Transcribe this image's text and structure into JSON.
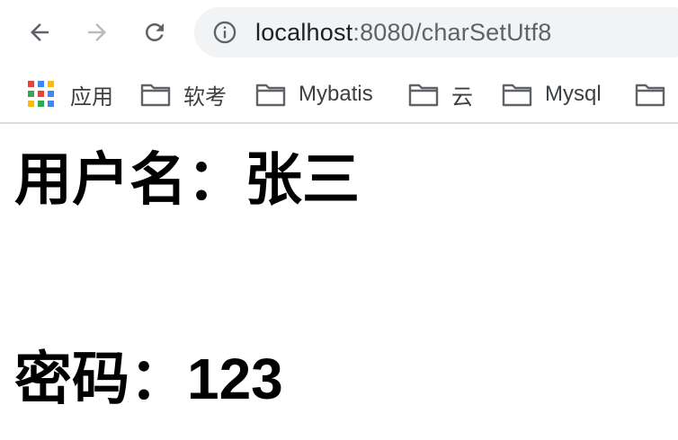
{
  "toolbar": {
    "url_host": "localhost",
    "url_rest": ":8080/charSetUtf8"
  },
  "bookmarks": {
    "apps_label": "应用",
    "items": [
      {
        "label": "软考"
      },
      {
        "label": "Mybatis"
      },
      {
        "label": "云"
      },
      {
        "label": "Mysql"
      },
      {
        "label": ""
      }
    ]
  },
  "apps_colors": [
    "#ea4335",
    "#4285f4",
    "#fbbc05",
    "#34a853",
    "#ea4335",
    "#4285f4",
    "#fbbc05",
    "#34a853",
    "#4285f4"
  ],
  "page": {
    "username_line": "用户名：张三",
    "password_line": "密码：123"
  }
}
